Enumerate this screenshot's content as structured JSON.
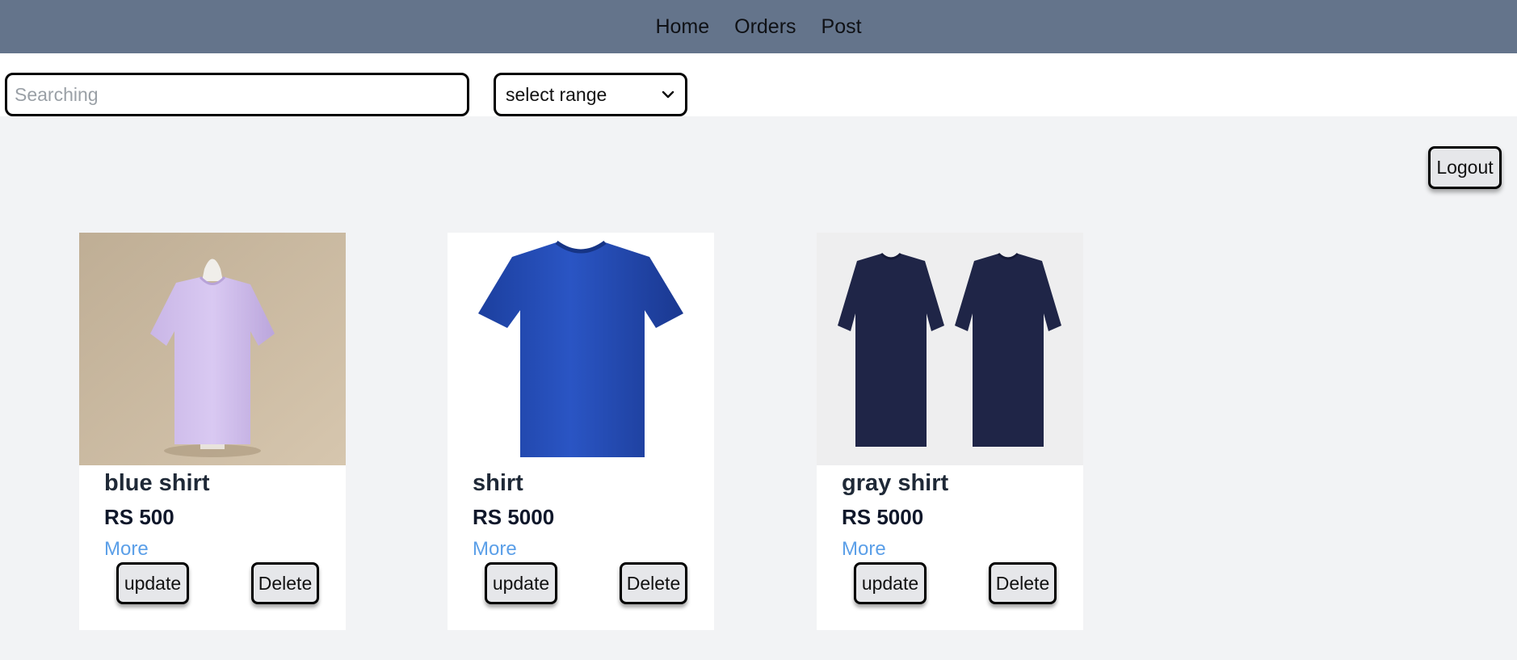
{
  "nav": {
    "items": [
      {
        "label": "Home"
      },
      {
        "label": "Orders"
      },
      {
        "label": "Post"
      }
    ]
  },
  "toolbar": {
    "search_placeholder": "Searching",
    "search_value": "",
    "range_select_value": "select range",
    "logout_label": "Logout"
  },
  "products": [
    {
      "title": "blue shirt",
      "price": "RS 500",
      "more_label": "More",
      "update_label": "update",
      "delete_label": "Delete",
      "image": "lavender-tshirt-on-mannequin"
    },
    {
      "title": "shirt",
      "price": "RS 5000",
      "more_label": "More",
      "update_label": "update",
      "delete_label": "Delete",
      "image": "blue-tshirt"
    },
    {
      "title": "gray shirt",
      "price": "RS 5000",
      "more_label": "More",
      "update_label": "update",
      "delete_label": "Delete",
      "image": "two-navy-tshirts"
    }
  ],
  "colors": {
    "navbar_bg": "#64748b",
    "page_bg": "#f2f3f5",
    "link": "#5b9fe8",
    "button_bg": "#e6e7ea"
  }
}
